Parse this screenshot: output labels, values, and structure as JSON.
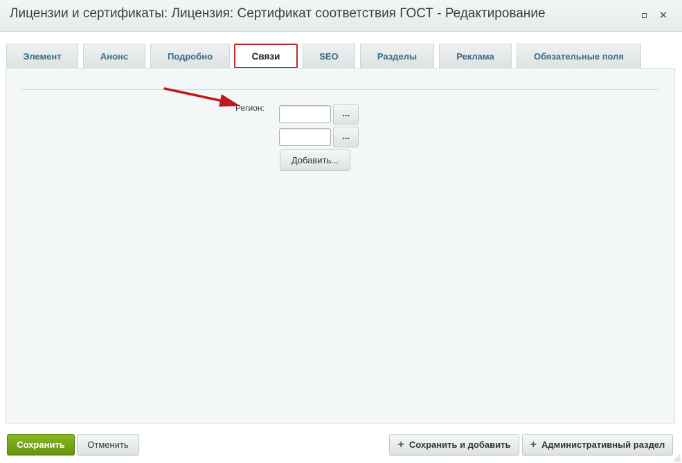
{
  "window": {
    "title": "Лицензии и сертификаты: Лицензия: Сертификат соответствия ГОСТ - Редактирование",
    "maximize_icon": "maximize-icon",
    "close_icon": "close-icon",
    "close_glyph": "✕"
  },
  "tabs": [
    {
      "label": "Элемент"
    },
    {
      "label": "Анонс"
    },
    {
      "label": "Подробно"
    },
    {
      "label": "Связи",
      "active": true
    },
    {
      "label": "SEO"
    },
    {
      "label": "Разделы"
    },
    {
      "label": "Реклама"
    },
    {
      "label": "Обязательные поля"
    }
  ],
  "form": {
    "region_label": "Регион:",
    "inputs": [
      {
        "value": "",
        "browse_label": "..."
      },
      {
        "value": "",
        "browse_label": "..."
      }
    ],
    "add_label": "Добавить..."
  },
  "footer": {
    "save_label": "Сохранить",
    "cancel_label": "Отменить",
    "save_add_label": "Сохранить и добавить",
    "admin_label": "Административный раздел",
    "plus_glyph": "+"
  },
  "colors": {
    "active_tab_border": "#b82b2b",
    "arrow": "#c0191b",
    "save_button": "#76a418",
    "tab_text": "#3d6a84"
  }
}
